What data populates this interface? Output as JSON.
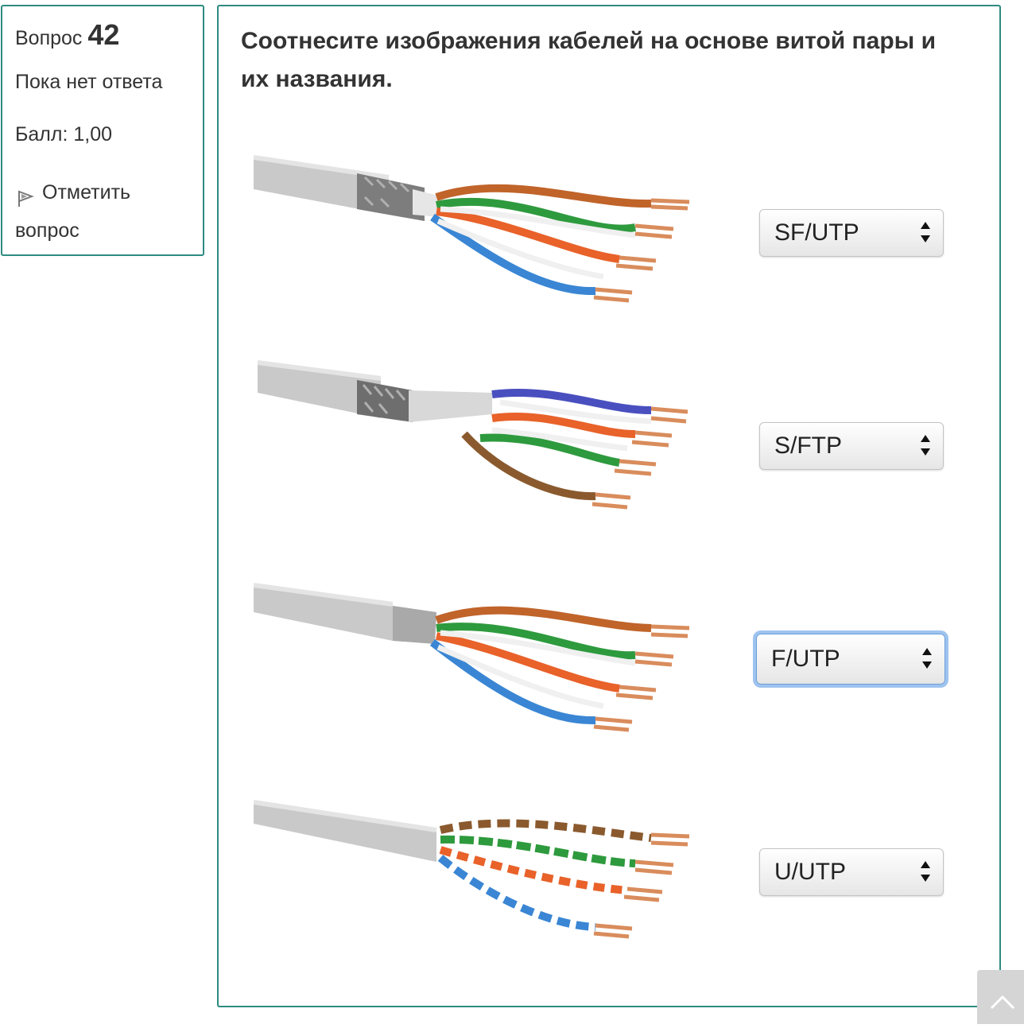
{
  "info": {
    "question_label": "Вопрос",
    "question_number": "42",
    "state": "Пока нет ответа",
    "grade": "Балл: 1,00",
    "flag_label": "Отметить вопрос"
  },
  "question": {
    "text": "Соотнесите изображения кабелей на основе витой пары и их названия."
  },
  "rows": [
    {
      "image_icon": "cable-sf-utp-image",
      "selected": "SF/UTP"
    },
    {
      "image_icon": "cable-s-ftp-image",
      "selected": "S/FTP"
    },
    {
      "image_icon": "cable-f-utp-image",
      "selected": "F/UTP"
    },
    {
      "image_icon": "cable-u-utp-image",
      "selected": "U/UTP"
    }
  ],
  "colors": {
    "border": "#2e8b82",
    "focus": "#9ec3ef",
    "jacket": "#c9c9c9",
    "pairs": [
      "#c0642a",
      "#2e9a3e",
      "#e8622a",
      "#3a86d4",
      "#4a4fbf",
      "#8a5a2e"
    ]
  }
}
